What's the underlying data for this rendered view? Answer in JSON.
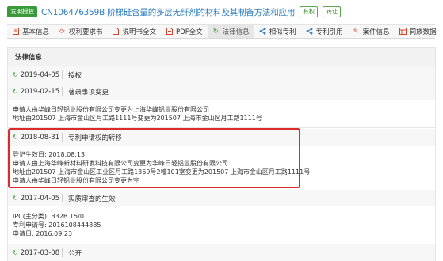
{
  "header": {
    "status_badge": "发明授权",
    "patent_title": "CN106476359B  阶梯硅含量的多层无纤剂的材料及其制备方法和应用",
    "badge_valid": "有权",
    "badge_transfer": "转让"
  },
  "tabs": [
    {
      "label": "基本信息",
      "icon": "document-icon",
      "color": "#d6452b"
    },
    {
      "label": "权利要求书",
      "icon": "sync-icon",
      "color": "#d6452b"
    },
    {
      "label": "说明书全文",
      "icon": "file-icon",
      "color": "#d6452b"
    },
    {
      "label": "PDF全文",
      "icon": "pdf-icon",
      "color": "#d6452b"
    },
    {
      "label": "法律信息",
      "icon": "refresh-icon",
      "color": "#3a9a3a",
      "active": true
    },
    {
      "label": "相似专利",
      "icon": "share-icon",
      "color": "#2f7fc2"
    },
    {
      "label": "专利引用",
      "icon": "link-icon",
      "color": "#2f7fc2"
    },
    {
      "label": "案件信息",
      "icon": "edit-icon",
      "color": "#d6452b"
    },
    {
      "label": "同族数据",
      "icon": "family-icon",
      "color": "#d6452b"
    }
  ],
  "legal": {
    "section_title": "法律信息",
    "records": [
      {
        "date": "2019-04-05",
        "event": "授权",
        "details": []
      },
      {
        "date": "2019-02-15",
        "event": "著录事项变更",
        "details": [
          "申请人由华峰日轻铝业股份有限公司变更为上海华峰铝业股份有限公司",
          "地址由201507 上海市金山区月工路1111号变更为201507 上海市金山区月工路1111号"
        ]
      },
      {
        "date": "2018-08-31",
        "event": "专利申请权的转移",
        "details": [
          "登记生效日: 2018.08.13",
          "申请人由上海华峰新材料研发科技有限公司变更为华峰日轻铝业股份有限公司",
          "地址由201507 上海市金山区工业区月工路1369号2幢101室变更为201507 上海市金山区月工路1111号",
          "申请人由华峰日轻铝业股份有限公司变更为空"
        ]
      },
      {
        "date": "2017-04-05",
        "event": "实质审查的生效",
        "details": [
          "IPC(主分类): B32B 15/01",
          "专利申请号: 2016108444885",
          "申请日: 2016.09.23"
        ]
      },
      {
        "date": "2017-03-08",
        "event": "公开",
        "details": []
      }
    ]
  },
  "colors": {
    "link_blue": "#2f7fc2",
    "green": "#3a9a3a",
    "highlight_red": "#d92b2b"
  }
}
